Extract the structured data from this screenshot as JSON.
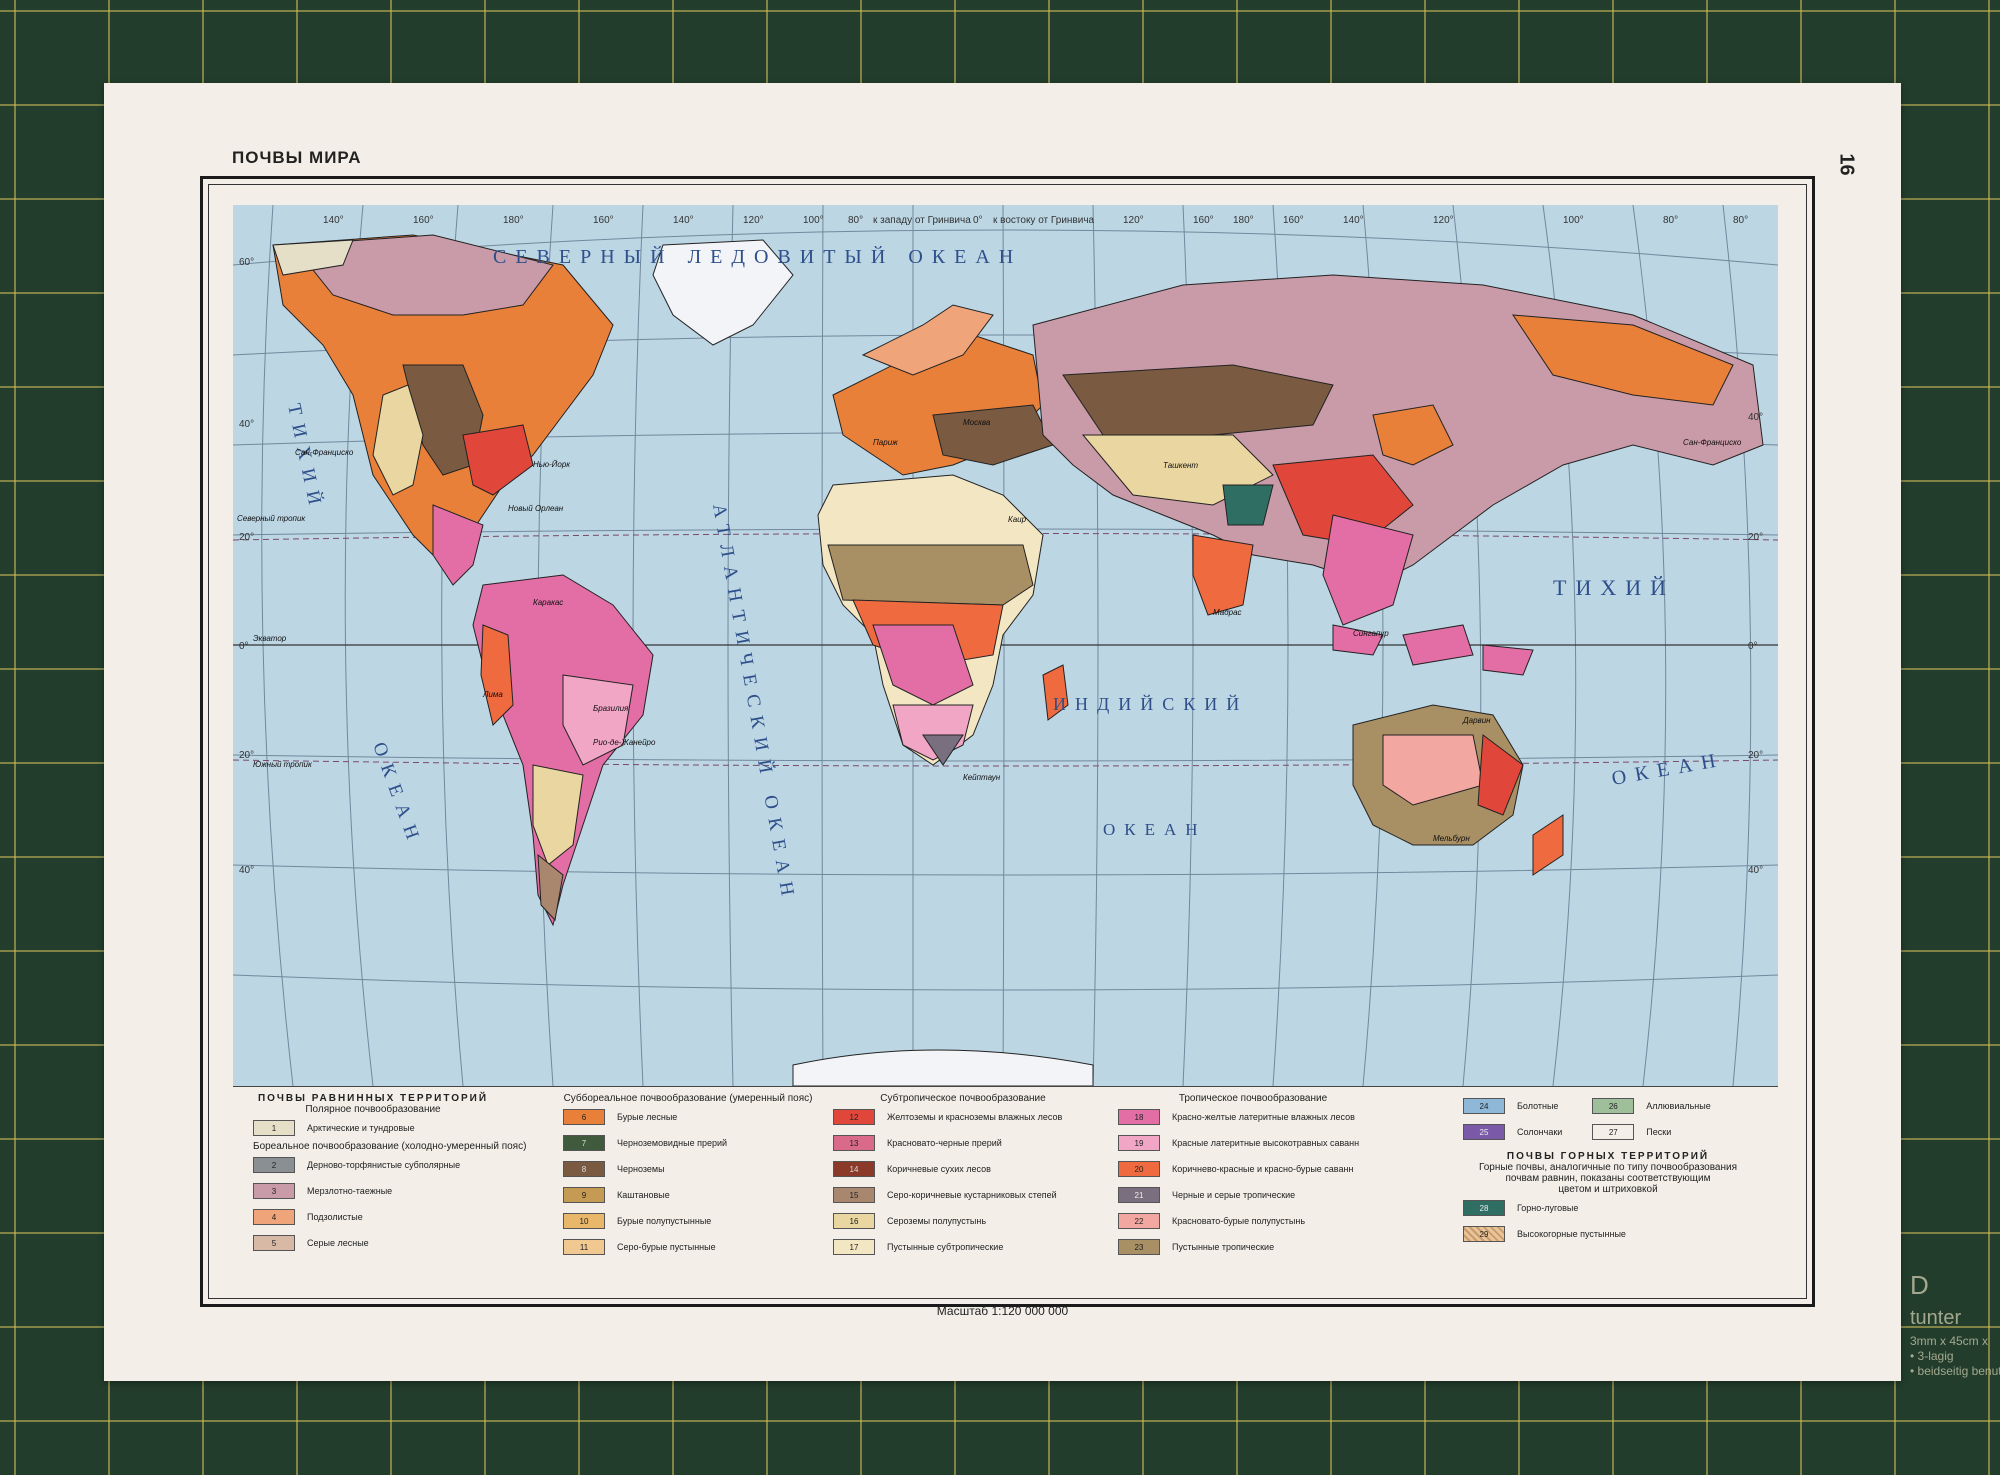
{
  "sheet": {
    "title": "ПОЧВЫ МИРА",
    "page_number": "16",
    "scale": "Масштаб 1:120 000 000"
  },
  "map": {
    "meridian_note_west": "к западу от Гринвича",
    "meridian_note_east": "к востоку от Гринвича",
    "longitude_labels": [
      "140°",
      "160°",
      "180°",
      "160°",
      "140°",
      "120°",
      "100°",
      "80°",
      "0°",
      "120°",
      "160°",
      "180°",
      "160°",
      "140°",
      "120°",
      "100°",
      "80°",
      "80°"
    ],
    "latitude_labels_left": [
      "60°",
      "40°",
      "20°",
      "0°",
      "20°",
      "40°"
    ],
    "latitude_labels_right": [
      "40°",
      "20°",
      "0°",
      "20°",
      "40°"
    ],
    "line_labels": {
      "north_tropic": "Северный тропик",
      "equator": "Экватор",
      "south_tropic": "Южный тропик"
    },
    "ocean_labels": {
      "arctic": "СЕВЕРНЫЙ ЛЕДОВИТЫЙ ОКЕАН",
      "atlantic": "АТЛАНТИЧЕСКИЙ ОКЕАН",
      "pacific_left_1": "ТИХИЙ",
      "pacific_left_2": "ОКЕАН",
      "pacific_right_1": "ТИХИЙ",
      "pacific_right_2": "ОКЕАН",
      "indian_1": "ИНДИЙСКИЙ",
      "indian_2": "ОКЕАН"
    },
    "cities": [
      "Сан-Франциско",
      "Нью-Йорк",
      "Новый Орлеан",
      "Каракас",
      "Лима",
      "Бразилия",
      "Рио-де-Жанейро",
      "Москва",
      "Париж",
      "Каир",
      "Ташкент",
      "Мадрас",
      "Кейптаун",
      "Сингапур",
      "Мельбурн",
      "Дарвин",
      "Сан-Франциско"
    ]
  },
  "legend": {
    "col1": {
      "head1": "ПОЧВЫ РАВНИННЫХ ТЕРРИТОРИЙ",
      "head2": "Полярное почвообразование",
      "items_polar": [
        {
          "num": "1",
          "label": "Арктические и тундровые",
          "color": "#e6dfc8"
        }
      ],
      "head3": "Бореальное почвообразование (холодно-умеренный пояс)",
      "items_boreal": [
        {
          "num": "2",
          "label": "Дерново-торфянистые субполярные",
          "color": "#8a8f94"
        },
        {
          "num": "3",
          "label": "Мерзлотно-таежные",
          "color": "#c99aa8"
        },
        {
          "num": "4",
          "label": "Подзолистые",
          "color": "#f0a47a"
        },
        {
          "num": "5",
          "label": "Серые лесные",
          "color": "#d8b9a6"
        }
      ]
    },
    "col2": {
      "head": "Суббореальное почвообразование (умеренный пояс)",
      "items": [
        {
          "num": "6",
          "label": "Бурые лесные",
          "color": "#e8803a"
        },
        {
          "num": "7",
          "label": "Черноземовидные прерий",
          "color": "#3f5a3c"
        },
        {
          "num": "8",
          "label": "Черноземы",
          "color": "#7a5a40"
        },
        {
          "num": "9",
          "label": "Каштановые",
          "color": "#c59a52"
        },
        {
          "num": "10",
          "label": "Бурые полупустынные",
          "color": "#e8b76a"
        },
        {
          "num": "11",
          "label": "Серо-бурые пустынные",
          "color": "#f0c890"
        }
      ]
    },
    "col3": {
      "head": "Субтропическое почвообразование",
      "items": [
        {
          "num": "12",
          "label": "Желтоземы и красноземы влажных лесов",
          "color": "#e0473a"
        },
        {
          "num": "13",
          "label": "Красновато-черные прерий",
          "color": "#d96a8a"
        },
        {
          "num": "14",
          "label": "Коричневые сухих лесов",
          "color": "#8b3a2a"
        },
        {
          "num": "15",
          "label": "Серо-коричневые кустарниковых степей",
          "color": "#a8876e"
        },
        {
          "num": "16",
          "label": "Сероземы полупустынь",
          "color": "#ead6a0"
        },
        {
          "num": "17",
          "label": "Пустынные субтропические",
          "color": "#f3e6c2"
        }
      ]
    },
    "col4": {
      "head": "Тропическое почвообразование",
      "items": [
        {
          "num": "18",
          "label": "Красно-желтые латеритные влажных лесов",
          "color": "#e36ea6"
        },
        {
          "num": "19",
          "label": "Красные латеритные высокотравных саванн",
          "color": "#f1a6c6"
        },
        {
          "num": "20",
          "label": "Коричнево-красные и красно-бурые саванн",
          "color": "#ef6a3e"
        },
        {
          "num": "21",
          "label": "Черные и серые тропические",
          "color": "#7a6f7e"
        },
        {
          "num": "22",
          "label": "Красновато-бурые полупустынь",
          "color": "#f2a7a0"
        },
        {
          "num": "23",
          "label": "Пустынные тропические",
          "color": "#a88f64"
        }
      ]
    },
    "col5": {
      "items_top": [
        {
          "num": "24",
          "label": "Болотные",
          "color": "#8fb7d8"
        },
        {
          "num": "25",
          "label": "Солончаки",
          "color": "#7a5aa8"
        },
        {
          "num": "26",
          "label": "Аллювиальные",
          "color": "#9fbf9a"
        },
        {
          "num": "27",
          "label": "Пески",
          "color": "#f3efe8"
        }
      ],
      "head1": "ПОЧВЫ ГОРНЫХ ТЕРРИТОРИЙ",
      "head2": "Горные почвы, аналогичные по типу почвообразования",
      "head3": "почвам равнин, показаны соответствующим",
      "head4": "цветом и штриховкой",
      "items_mountain": [
        {
          "num": "28",
          "label": "Горно-луговые",
          "color": "#2f6e62"
        },
        {
          "num": "29",
          "label": "Высокогорные пустынные",
          "color": "#e8c49a"
        }
      ]
    }
  },
  "colors": {
    "ocean": "#bcd6e4",
    "graticule": "#5a6f86",
    "mat": "#223d2c",
    "paper": "#f3efe8"
  }
}
